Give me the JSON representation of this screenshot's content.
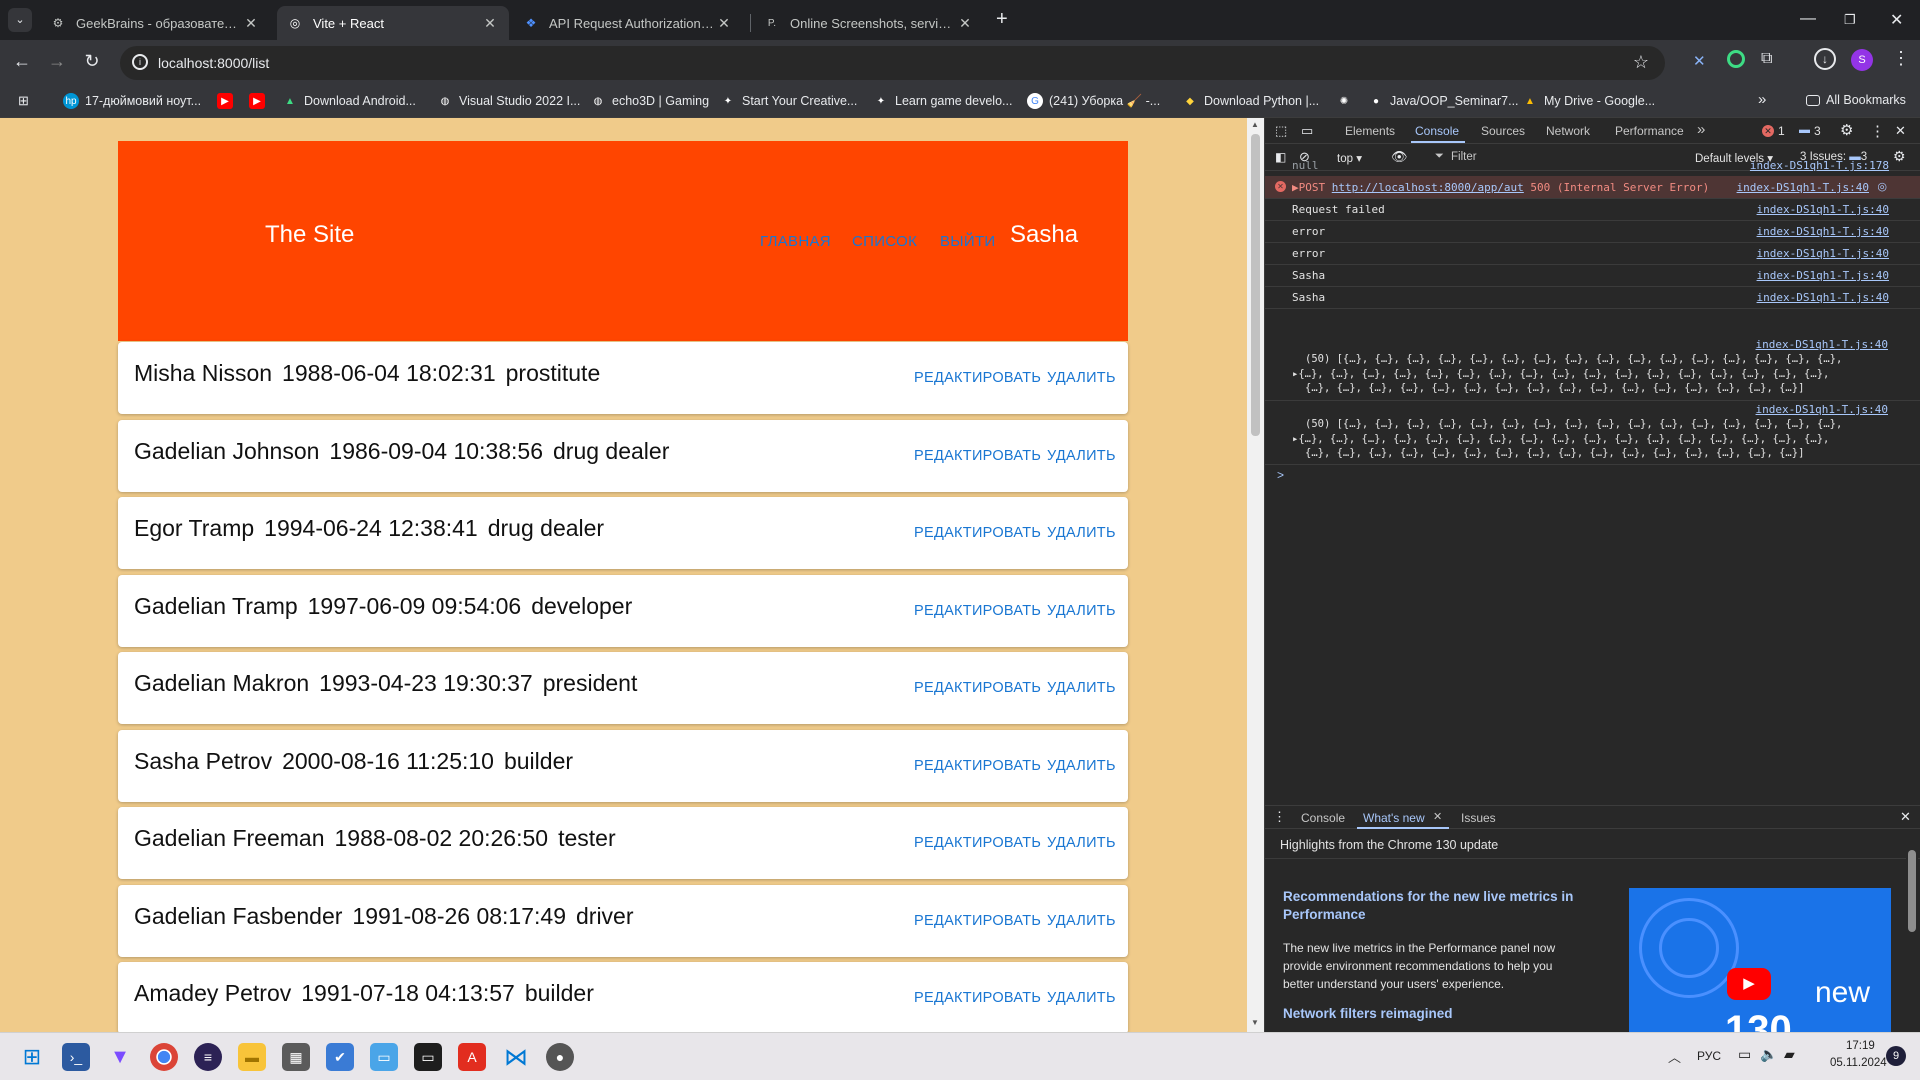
{
  "browser": {
    "tabs": [
      {
        "title": "GeekBrains - образовательный",
        "active": false
      },
      {
        "title": "Vite + React",
        "active": true
      },
      {
        "title": "API Request Authorization - Dr",
        "active": false
      },
      {
        "title": "Online Screenshots, service for",
        "active": false
      }
    ],
    "new_tab": "+",
    "url": "localhost:8000/list",
    "profile_initial": "S",
    "bookmarks": [
      "17-дюймовий ноут...",
      "Download Android...",
      "Visual Studio 2022 I...",
      "echo3D | Gaming",
      "Start Your Creative...",
      "Learn game develo...",
      "(241) Уборка 🧹 -...",
      "Download Python |...",
      "Java/OOP_Seminar7...",
      "My Drive - Google..."
    ],
    "more_bookmarks": "»",
    "all_bookmarks": "All Bookmarks"
  },
  "site": {
    "title": "The Site",
    "nav": [
      "ГЛАВНАЯ",
      "СПИСОК",
      "ВЫЙТИ"
    ],
    "user": "Sasha",
    "edit_label": "РЕДАКТИРОВАТЬ",
    "delete_label": "УДАЛИТЬ",
    "people": [
      {
        "name": "Misha Nisson",
        "date": "1988-06-04 18:02:31",
        "job": "prostitute"
      },
      {
        "name": "Gadelian Johnson",
        "date": "1986-09-04 10:38:56",
        "job": "drug dealer"
      },
      {
        "name": "Egor Tramp",
        "date": "1994-06-24 12:38:41",
        "job": "drug dealer"
      },
      {
        "name": "Gadelian Tramp",
        "date": "1997-06-09 09:54:06",
        "job": "developer"
      },
      {
        "name": "Gadelian Makron",
        "date": "1993-04-23 19:30:37",
        "job": "president"
      },
      {
        "name": "Sasha Petrov",
        "date": "2000-08-16 11:25:10",
        "job": "builder"
      },
      {
        "name": "Gadelian Freeman",
        "date": "1988-08-02 20:26:50",
        "job": "tester"
      },
      {
        "name": "Gadelian Fasbender",
        "date": "1991-08-26 08:17:49",
        "job": "driver"
      },
      {
        "name": "Amadey Petrov",
        "date": "1991-07-18 04:13:57",
        "job": "builder"
      }
    ]
  },
  "devtools": {
    "tabs": [
      "Elements",
      "Console",
      "Sources",
      "Network",
      "Performance"
    ],
    "active_tab": "Console",
    "error_count": "1",
    "message_count": "3",
    "context": "top",
    "filter_placeholder": "Filter",
    "levels": "Default levels",
    "issues": "3 Issues:",
    "issues_count": "3",
    "console": [
      {
        "text": "null",
        "src": "index-DS1qh1-T.js:178",
        "kind": "log"
      },
      {
        "text": "▶POST ",
        "link": "http://localhost:8000/app/aut",
        "rest": " 500 (Internal Server Error)",
        "src": "index-DS1qh1-T.js:40",
        "kind": "error"
      },
      {
        "text": "Request failed",
        "src": "index-DS1qh1-T.js:40",
        "kind": "log"
      },
      {
        "text": "error",
        "src": "index-DS1qh1-T.js:40",
        "kind": "log"
      },
      {
        "text": "error",
        "src": "index-DS1qh1-T.js:40",
        "kind": "log"
      },
      {
        "text": "Sasha",
        "src": "index-DS1qh1-T.js:40",
        "kind": "log"
      },
      {
        "text": "Sasha",
        "src": "index-DS1qh1-T.js:40",
        "kind": "log"
      }
    ],
    "array_src": "index-DS1qh1-T.js:40",
    "array_head": "(50) [{…}, {…}, {…}, {…}, {…}, {…}, {…}, {…}, {…}, {…}, {…}, {…}, {…}, {…}, {…}, {…},",
    "array_mid": "{…}, {…}, {…}, {…}, {…}, {…}, {…}, {…}, {…}, {…}, {…}, {…}, {…}, {…}, {…}, {…}, {…},",
    "array_tail": "{…}, {…}, {…}, {…}, {…}, {…}, {…}, {…}, {…}, {…}, {…}, {…}, {…}, {…}, {…}, {…}]",
    "prompt": ">",
    "drawer_tabs": [
      "Console",
      "What's new",
      "Issues"
    ],
    "drawer_active": "What's new",
    "highlights": "Highlights from the Chrome 130 update",
    "news_title": "Recommendations for the new live metrics in Performance",
    "news_body": "The new live metrics in the Performance panel now provide environment recommendations to help you better understand your users' experience.",
    "news_title2": "Network filters reimagined",
    "video_text": "new",
    "video_num": "130"
  },
  "taskbar": {
    "lang": "РУС",
    "time": "17:19",
    "date": "05.11.2024",
    "notifications": "9"
  },
  "colors": {
    "header": "#ff4500",
    "page_bg": "#f0cb8a",
    "link": "#1976d2",
    "error": "#f28b82"
  }
}
